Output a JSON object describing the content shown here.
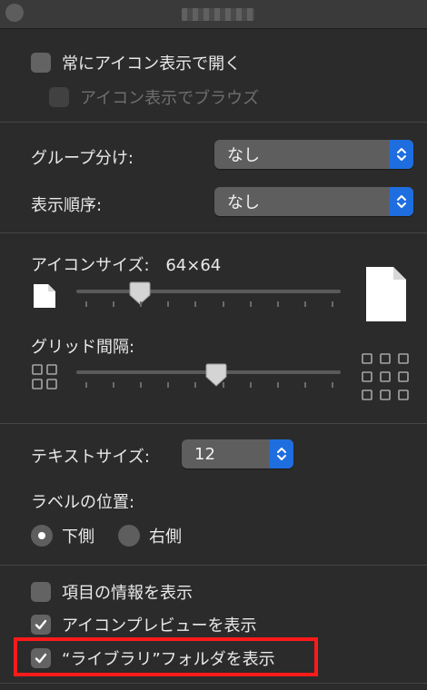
{
  "window": {
    "title_obscured": true
  },
  "view_options": {
    "always_open_in_icon_view": {
      "label": "常にアイコン表示で開く",
      "checked": false,
      "enabled": true
    },
    "browse_in_icon_view": {
      "label": "アイコン表示でブラウズ",
      "checked": false,
      "enabled": false
    },
    "group_by": {
      "label": "グループ分け:",
      "value": "なし"
    },
    "sort_by": {
      "label": "表示順序:",
      "value": "なし"
    },
    "icon_size": {
      "label": "アイコンサイズ:",
      "value": "64×64",
      "slider_fraction": 0.24
    },
    "grid_spacing": {
      "label": "グリッド間隔:",
      "slider_fraction": 0.53
    },
    "text_size": {
      "label": "テキストサイズ:",
      "value": "12"
    },
    "label_position": {
      "label": "ラベルの位置:",
      "options": [
        {
          "label": "下側",
          "selected": true
        },
        {
          "label": "右側",
          "selected": false
        }
      ]
    },
    "show_item_info": {
      "label": "項目の情報を表示",
      "checked": false
    },
    "show_icon_preview": {
      "label": "アイコンプレビューを表示",
      "checked": true
    },
    "show_library_folder": {
      "label": "“ライブラリ”フォルダを表示",
      "checked": true,
      "highlighted": true
    }
  },
  "colors": {
    "accent": "#1f6ee0",
    "highlight": "#ff1a1a",
    "background": "#2b2b2b"
  }
}
